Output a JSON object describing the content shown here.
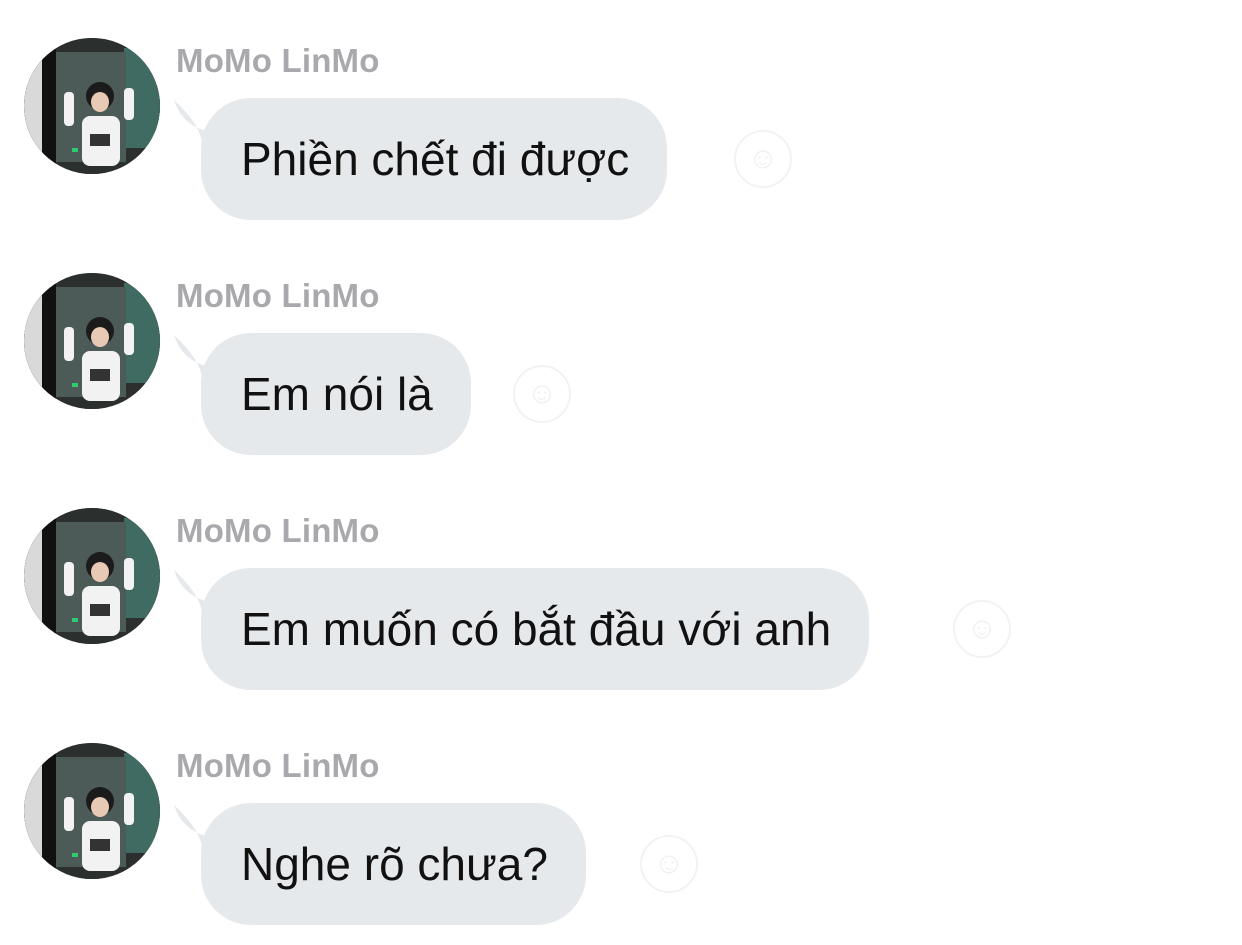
{
  "messages": [
    {
      "sender": "MoMo LinMo",
      "text": "Phiền chết đi được",
      "react_icon": "add-reaction-icon"
    },
    {
      "sender": "MoMo LinMo",
      "text": "Em nói là",
      "react_icon": "add-reaction-icon"
    },
    {
      "sender": "MoMo LinMo",
      "text": "Em muốn có bắt đầu với anh",
      "react_icon": "add-reaction-icon"
    },
    {
      "sender": "MoMo LinMo",
      "text": "Nghe rõ chưa?",
      "react_icon": "add-reaction-icon"
    }
  ],
  "colors": {
    "bubble": "#e6e9ec",
    "sender_name": "#a9a9ad",
    "message_text": "#111111",
    "background": "#ffffff"
  }
}
